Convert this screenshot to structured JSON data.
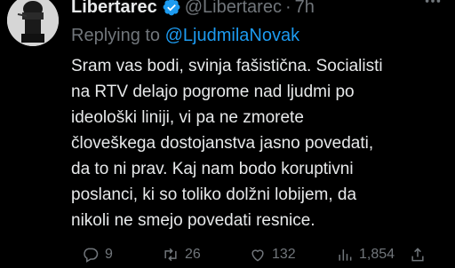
{
  "tweet": {
    "author_name": "Libertarec",
    "author_handle": "@Libertarec",
    "separator": "·",
    "time": "7h",
    "reply_prefix": "Replying to",
    "reply_mention": "@LjudmilaNovak",
    "body_lines": [
      "Sram vas bodi, svinja fašistična. Socialisti",
      "na RTV delajo pogrome nad ljudmi po",
      "ideološki liniji, vi pa ne zmorete",
      "človeškega dostojanstva jasno povedati,",
      "da to ni prav. Kaj nam bodo koruptivni",
      "poslanci, ki so toliko dolžni lobijem, da",
      "nikoli ne smejo povedati resnice."
    ],
    "stats": {
      "replies": "9",
      "retweets": "26",
      "likes": "132",
      "views": "1,854"
    }
  },
  "icons": {
    "verified": "verified-badge-icon",
    "more": "more-horizontal-icon",
    "reply": "reply-icon",
    "retweet": "retweet-icon",
    "like": "heart-icon",
    "views": "views-chart-icon",
    "share": "share-icon"
  },
  "colors": {
    "background": "#000000",
    "text": "#e7e9ea",
    "secondary": "#71767b",
    "accent": "#1d9bf0"
  }
}
